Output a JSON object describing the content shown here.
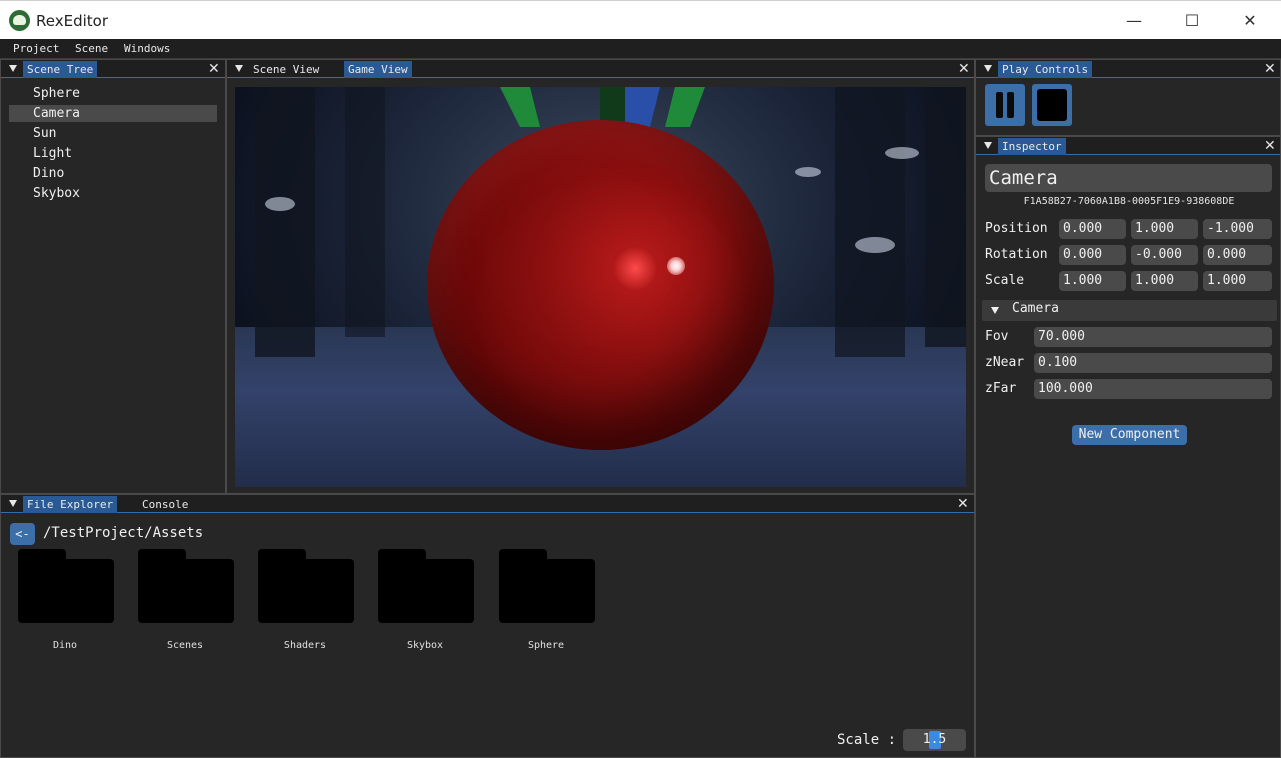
{
  "window": {
    "title": "RexEditor",
    "minimize_glyph": "—",
    "maximize_glyph": "☐",
    "close_glyph": "✕"
  },
  "menu": {
    "items": [
      "Project",
      "Scene",
      "Windows"
    ]
  },
  "scene_tree": {
    "tab_label": "Scene Tree",
    "items": [
      "Sphere",
      "Camera",
      "Sun",
      "Light",
      "Dino",
      "Skybox"
    ],
    "selected": "Camera"
  },
  "viewport": {
    "tabs": [
      "Scene View",
      "Game View"
    ],
    "active_tab": "Game View"
  },
  "play_controls": {
    "tab_label": "Play Controls",
    "buttons": [
      "pause-icon",
      "stop-icon"
    ]
  },
  "inspector": {
    "tab_label": "Inspector",
    "object_name": "Camera",
    "uuid": "F1A58B27-7060A1B8-0005F1E9-938608DE",
    "transform": {
      "position": {
        "label": "Position",
        "x": "0.000",
        "y": "1.000",
        "z": "-1.000"
      },
      "rotation": {
        "label": "Rotation",
        "x": "0.000",
        "y": "-0.000",
        "z": "0.000"
      },
      "scale": {
        "label": "Scale",
        "x": "1.000",
        "y": "1.000",
        "z": "1.000"
      }
    },
    "component": {
      "header": "Camera",
      "fields": [
        {
          "label": "Fov",
          "value": "70.000"
        },
        {
          "label": "zNear",
          "value": "0.100"
        },
        {
          "label": "zFar",
          "value": "100.000"
        }
      ]
    },
    "new_component_label": "New Component"
  },
  "bottom": {
    "tabs": [
      "File Explorer",
      "Console"
    ],
    "active_tab": "File Explorer",
    "back_label": "<-",
    "path": "/TestProject/Assets",
    "folders": [
      "Dino",
      "Scenes",
      "Shaders",
      "Skybox",
      "Sphere"
    ],
    "scale_label": "Scale :",
    "scale_value": "1.5"
  },
  "colors": {
    "accent": "#295a95",
    "button": "#3c6fa8",
    "panel_bg": "#262626",
    "sphere": "#8a0f0f"
  }
}
